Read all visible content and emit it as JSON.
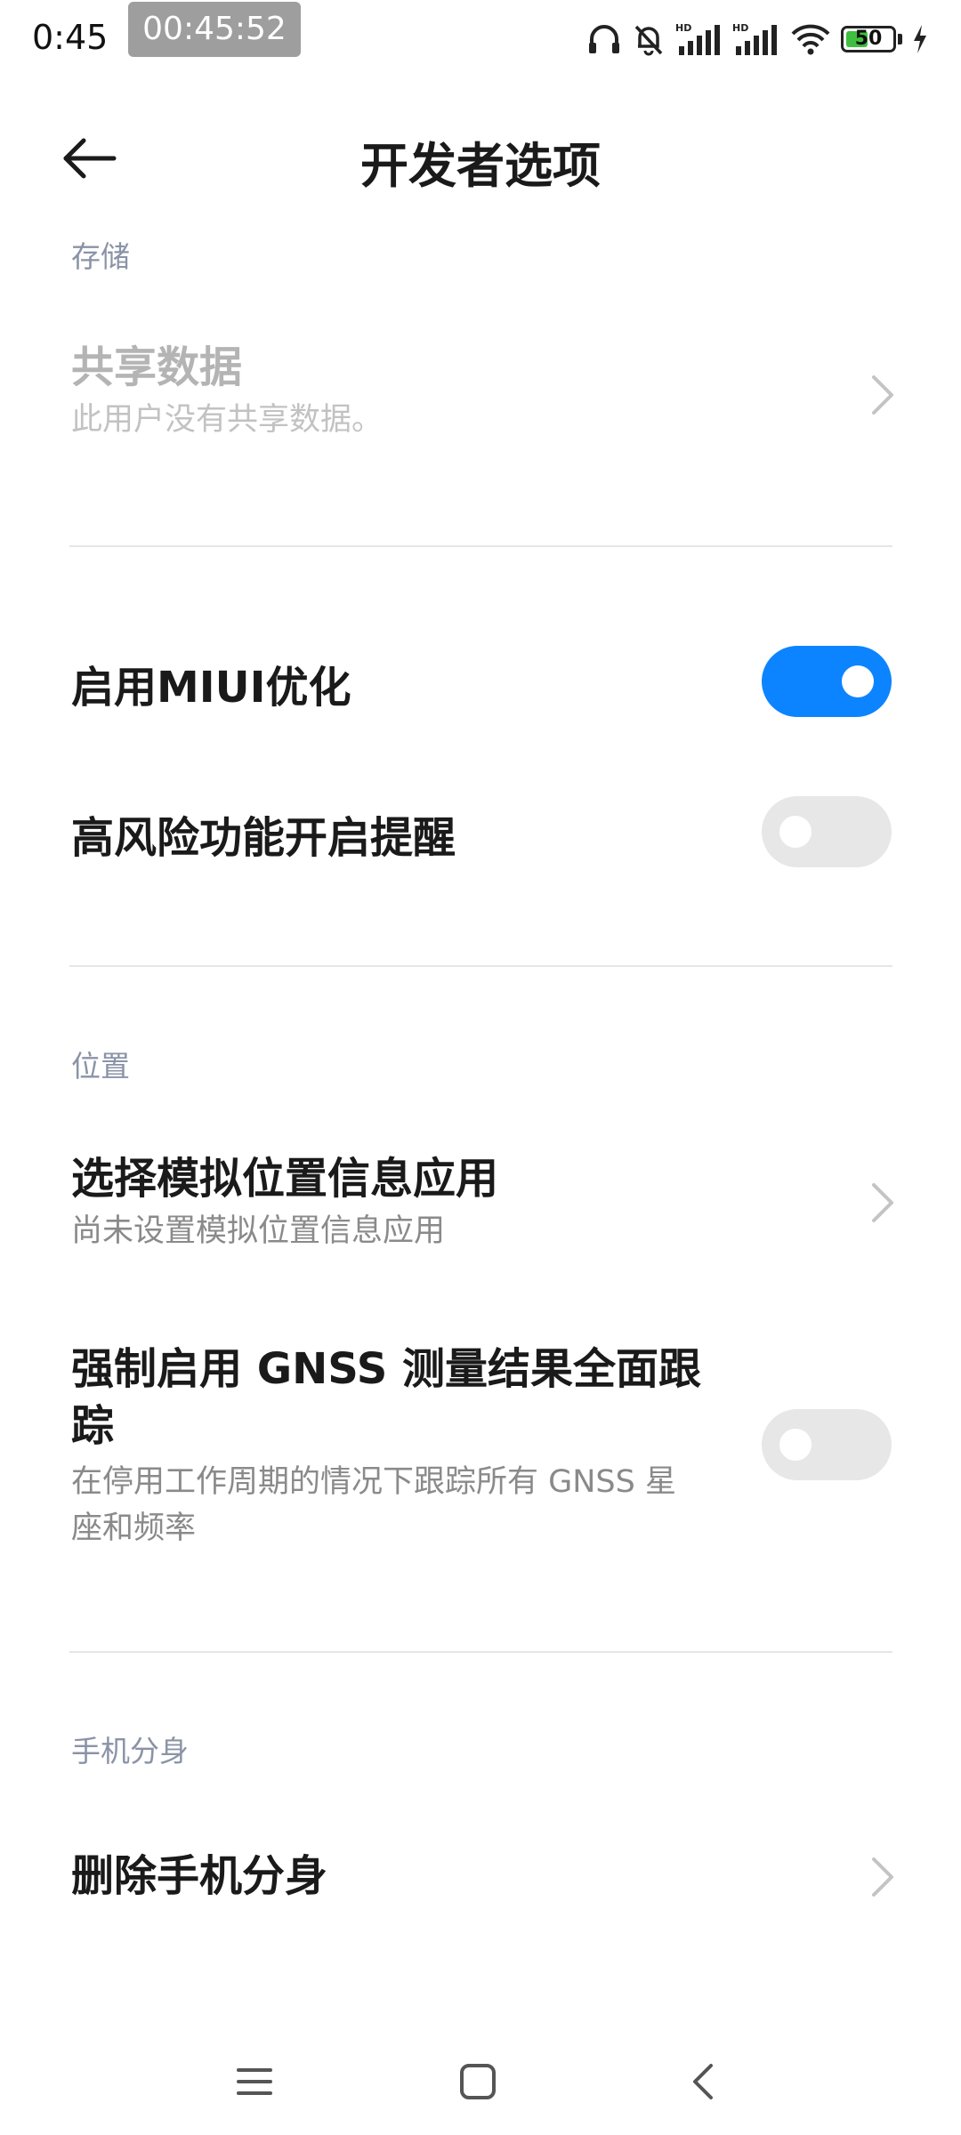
{
  "status_bar": {
    "time": "0:45",
    "recording_timer": "00:45:52",
    "battery_level": "50",
    "icons": [
      "headphones-icon",
      "bell-muted-icon",
      "signal-hd-icon",
      "signal-hd-icon",
      "wifi-icon",
      "battery-icon",
      "charging-icon"
    ]
  },
  "header": {
    "title": "开发者选项",
    "back_icon": "arrow-left-icon"
  },
  "sections": {
    "storage": {
      "header": "存储",
      "shared_data": {
        "title": "共享数据",
        "subtitle": "此用户没有共享数据。"
      }
    },
    "misc": {
      "miui_optimization": {
        "title": "启用MIUI优化",
        "enabled": true
      },
      "high_risk_alert": {
        "title": "高风险功能开启提醒",
        "enabled": false
      }
    },
    "location": {
      "header": "位置",
      "mock_location": {
        "title": "选择模拟位置信息应用",
        "subtitle": "尚未设置模拟位置信息应用"
      },
      "gnss": {
        "title_line1": "强制启用 GNSS 测量结果全面跟",
        "title_line2": "踪",
        "subtitle_line1": "在停用工作周期的情况下跟踪所有 GNSS 星",
        "subtitle_line2": "座和频率",
        "enabled": false
      }
    },
    "dual_apps": {
      "header": "手机分身",
      "delete_clone": {
        "title": "删除手机分身"
      }
    }
  },
  "nav_bar": {
    "menu_icon": "menu-icon",
    "home_icon": "home-square-icon",
    "back_icon": "back-triangle-icon"
  },
  "colors": {
    "accent": "#0d84ff",
    "section_header": "#8a93a6",
    "toggle_off": "#e7e7e7"
  }
}
